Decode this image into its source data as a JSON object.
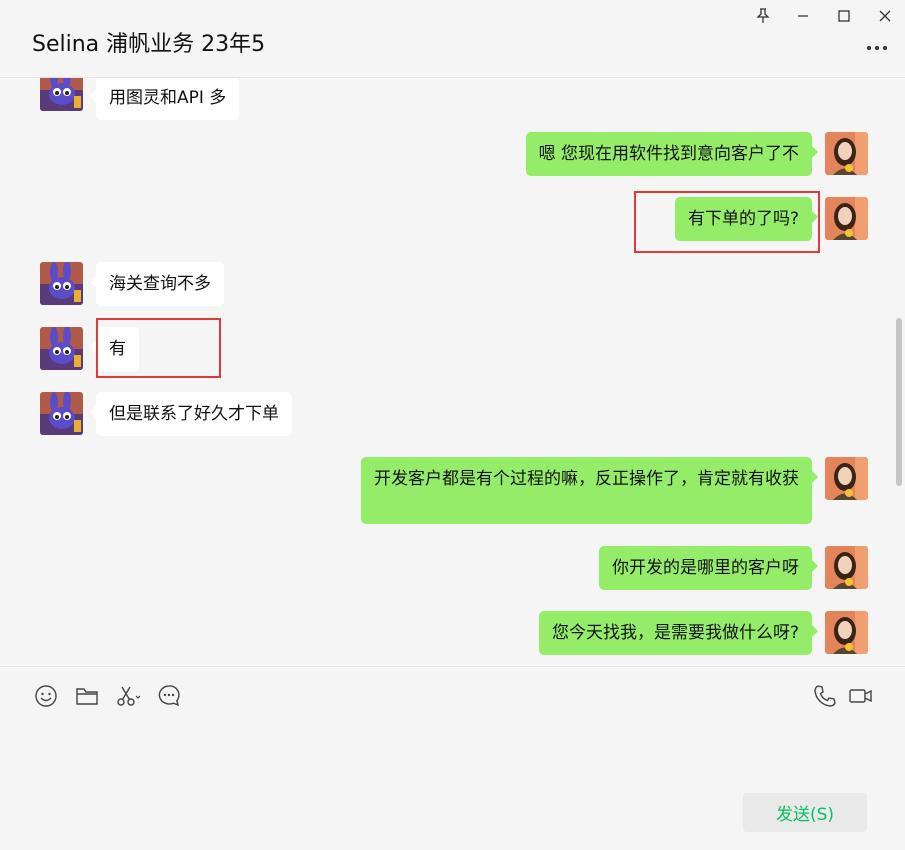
{
  "window": {
    "title": "Selina 浦帆业务 23年5"
  },
  "icons": {
    "pin": "pin-icon",
    "minimize": "minimize-icon",
    "maximize": "maximize-icon",
    "close": "close-icon",
    "more": "more-icon",
    "emoji": "emoji-icon",
    "folder": "folder-icon",
    "scissors": "scissors-icon",
    "chat_history": "chat-history-icon",
    "phone": "phone-icon",
    "video": "video-icon"
  },
  "messages": [
    {
      "side": "left",
      "text": "用图灵和API 多"
    },
    {
      "side": "right",
      "text": "嗯 您现在用软件找到意向客户了不"
    },
    {
      "side": "right",
      "text": "有下单的了吗?"
    },
    {
      "side": "left",
      "text": "海关查询不多"
    },
    {
      "side": "left",
      "text": "有"
    },
    {
      "side": "left",
      "text": "但是联系了好久才下单"
    },
    {
      "side": "right",
      "text": "开发客户都是有个过程的嘛，反正操作了，肯定就有收获"
    },
    {
      "side": "right",
      "text": "你开发的是哪里的客户呀"
    },
    {
      "side": "right",
      "text": "您今天找我，是需要我做什么呀?"
    }
  ],
  "composer": {
    "value": "",
    "send_label": "发送(S)"
  },
  "colors": {
    "sent_bubble": "#95ec69",
    "received_bubble": "#ffffff",
    "highlight_box": "#e03a3a",
    "send_text": "#07c160"
  }
}
